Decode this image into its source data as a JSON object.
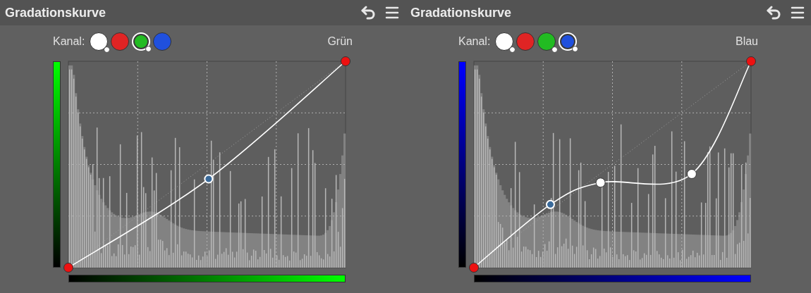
{
  "panels": [
    {
      "title": "Gradationskurve",
      "channel_label": "Kanal:",
      "channel_name": "Grün",
      "channels": [
        {
          "color": "#ffffff",
          "selected": false,
          "modified": true
        },
        {
          "color": "#e02424",
          "selected": false,
          "modified": false
        },
        {
          "color": "#22bb22",
          "selected": true,
          "modified": true
        },
        {
          "color": "#2050dd",
          "selected": false,
          "modified": false
        }
      ]
    },
    {
      "title": "Gradationskurve",
      "channel_label": "Kanal:",
      "channel_name": "Blau",
      "channels": [
        {
          "color": "#ffffff",
          "selected": false,
          "modified": true
        },
        {
          "color": "#e02424",
          "selected": false,
          "modified": false
        },
        {
          "color": "#22bb22",
          "selected": false,
          "modified": true
        },
        {
          "color": "#2050dd",
          "selected": true,
          "modified": true
        }
      ]
    }
  ]
}
